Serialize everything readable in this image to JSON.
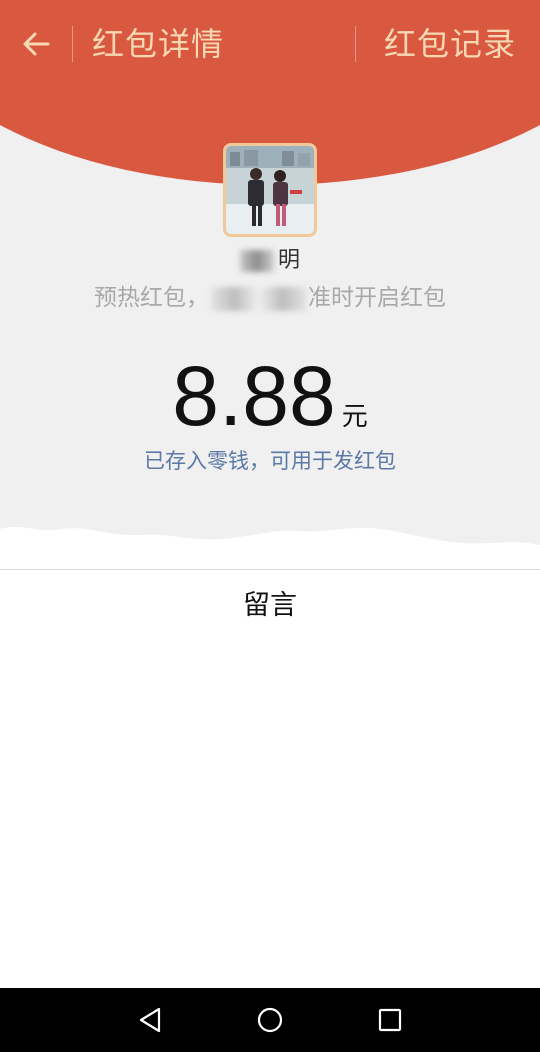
{
  "header": {
    "title": "红包详情",
    "records_label": "红包记录",
    "back_icon": "arrow-left-icon"
  },
  "sender": {
    "name_visible": "明"
  },
  "greeting": {
    "prefix": "预热红包，",
    "suffix": "准时开启红包"
  },
  "amount": {
    "value": "8.88",
    "unit": "元"
  },
  "note": "已存入零钱，可用于发红包",
  "message_section": {
    "title": "留言"
  },
  "nav": {
    "back_icon": "triangle-back-icon",
    "home_icon": "circle-home-icon",
    "recents_icon": "square-recents-icon"
  },
  "colors": {
    "header_red": "#d95940",
    "header_text": "#f7d8b2",
    "link_blue": "#5b79a6",
    "background_gray": "#f1f0f0"
  }
}
